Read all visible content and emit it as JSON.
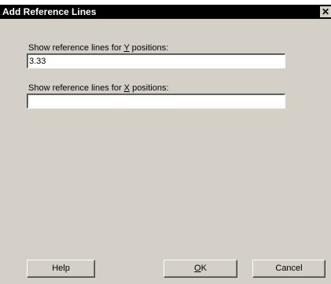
{
  "window": {
    "title": "Add Reference Lines",
    "close_glyph": "✕"
  },
  "y_field": {
    "label_prefix": "Show reference lines for ",
    "label_key": "Y",
    "label_suffix": " positions:",
    "value": "3.33"
  },
  "x_field": {
    "label_prefix": "Show reference lines for ",
    "label_key": "X",
    "label_suffix": " positions:",
    "value": ""
  },
  "buttons": {
    "help_label": "Help",
    "ok_key": "O",
    "ok_rest": "K",
    "cancel_label": "Cancel"
  }
}
